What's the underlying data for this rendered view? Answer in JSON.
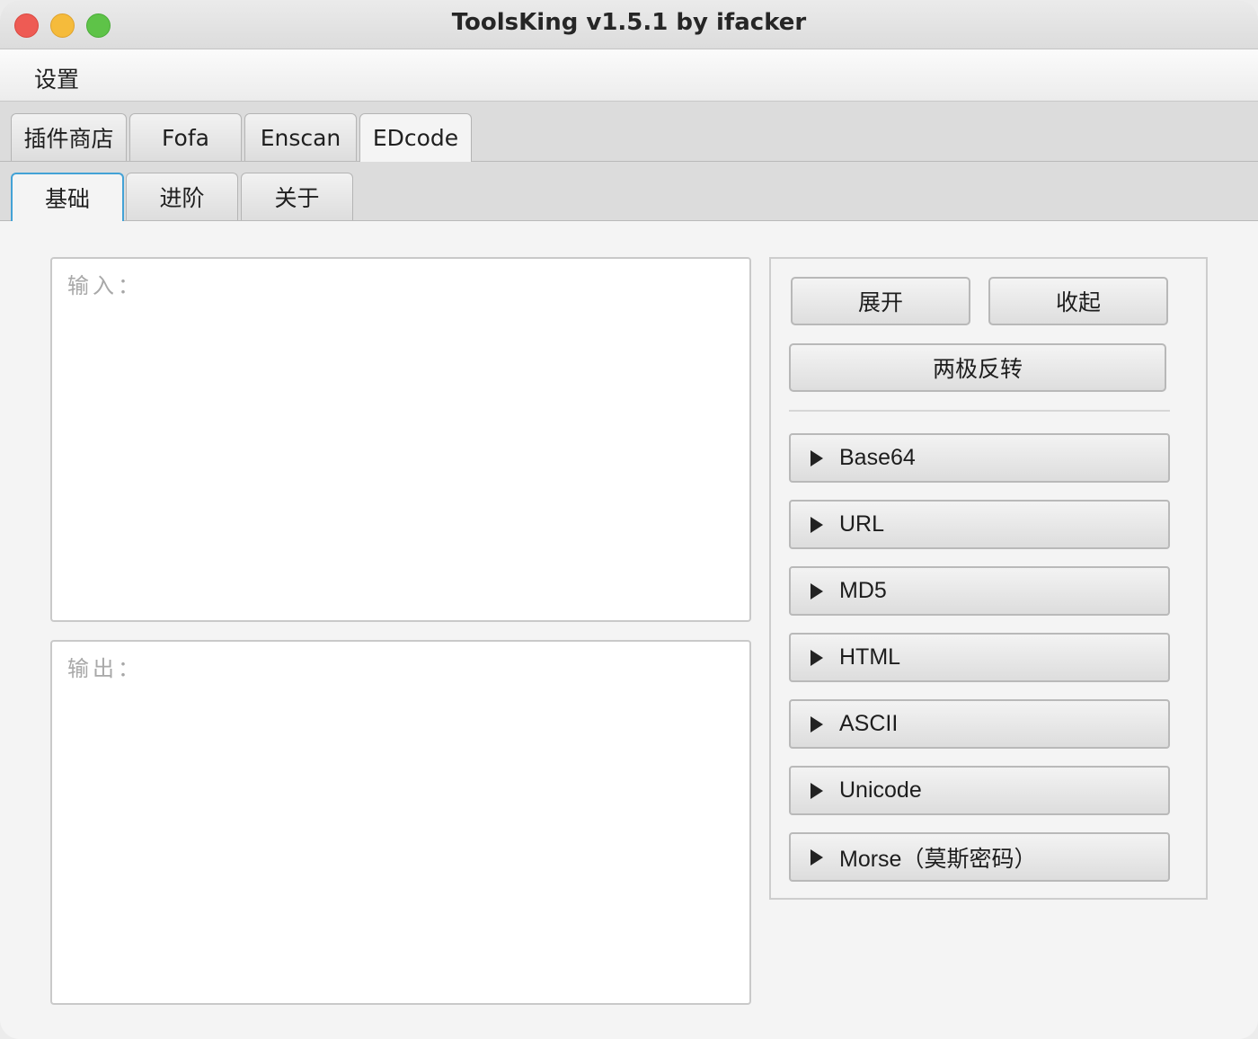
{
  "window": {
    "title": "ToolsKing v1.5.1 by ifacker"
  },
  "menu": {
    "items": [
      "设置"
    ]
  },
  "top_tabs": [
    {
      "label": "插件商店"
    },
    {
      "label": "Fofa"
    },
    {
      "label": "Enscan"
    },
    {
      "label": "EDcode",
      "selected": true
    }
  ],
  "sub_tabs": [
    {
      "label": "基础",
      "selected": true
    },
    {
      "label": "进阶"
    },
    {
      "label": "关于"
    }
  ],
  "input": {
    "placeholder": "输入：",
    "value": ""
  },
  "output": {
    "placeholder": "输出：",
    "value": ""
  },
  "actions": {
    "expand": "展开",
    "collapse": "收起",
    "invert": "两极反转"
  },
  "panes": [
    {
      "label": "Base64",
      "expanded": false
    },
    {
      "label": "URL",
      "expanded": false
    },
    {
      "label": "MD5",
      "expanded": false
    },
    {
      "label": "HTML",
      "expanded": false
    },
    {
      "label": "ASCII",
      "expanded": false
    },
    {
      "label": "Unicode",
      "expanded": false
    },
    {
      "label": "Morse（莫斯密码）",
      "expanded": false
    }
  ],
  "colors": {
    "focus_blue": "#43a2d6",
    "window_bg": "#f4f4f4"
  },
  "icons": [
    "close-icon",
    "minimize-icon",
    "maximize-icon",
    "triangle-right-icon"
  ]
}
